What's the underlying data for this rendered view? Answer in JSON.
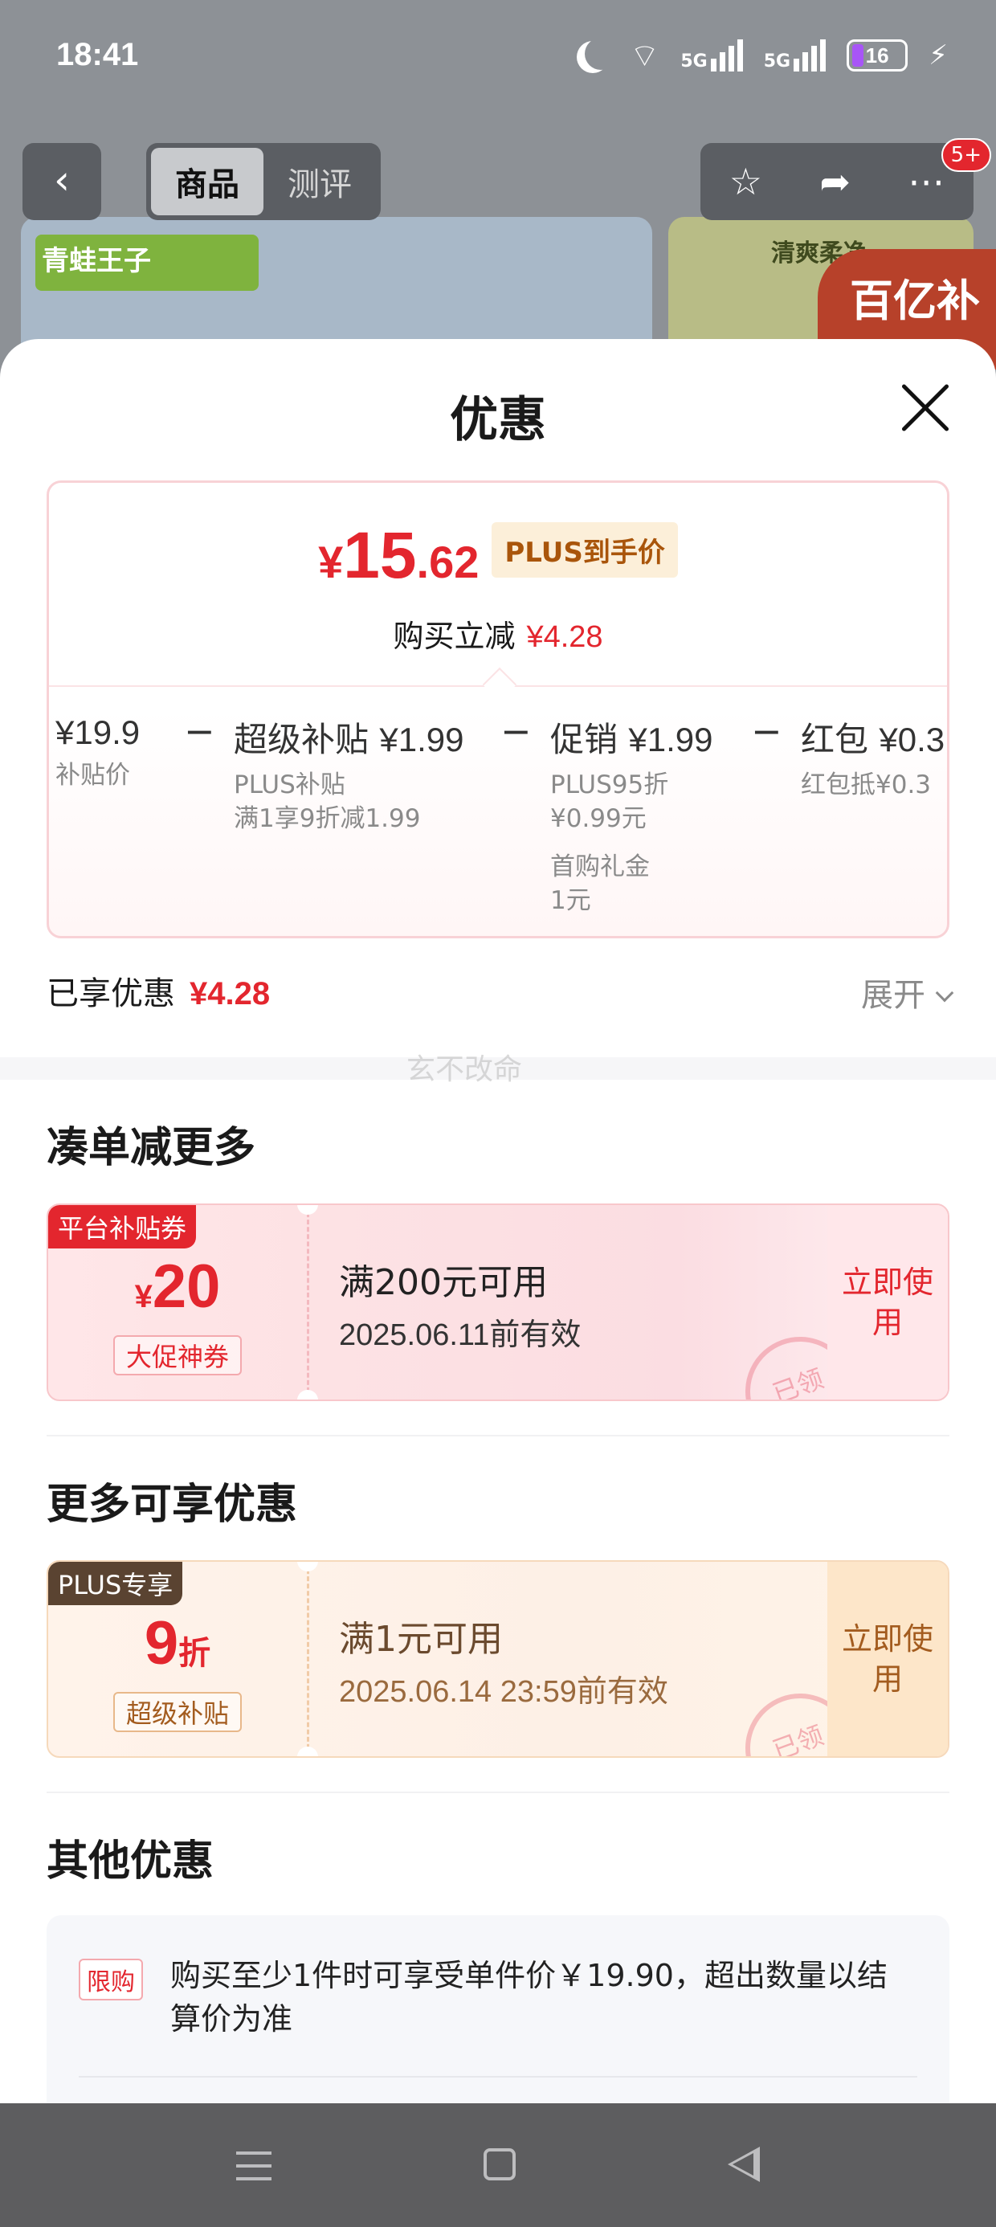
{
  "status_bar": {
    "time": "18:41",
    "signal1": "5G",
    "signal2": "5G",
    "battery": "16"
  },
  "product_nav": {
    "back_icon": "chevron-left-icon",
    "tabs": [
      "商品",
      "测评"
    ],
    "active_tab": "商品",
    "actions": [
      "star-icon",
      "share-icon",
      "more-icon"
    ],
    "badge": "5+"
  },
  "background": {
    "brand_logo": "青蛙王子",
    "product2_title": "清爽柔净",
    "tag": "百亿补贴"
  },
  "sheet": {
    "title": "优惠",
    "close_icon": "close-icon"
  },
  "price_card": {
    "currency": "¥",
    "price_int": "15",
    "price_dec": ".62",
    "plus_tag": "PLUS到手价",
    "instant_label": "购买立减",
    "instant_amount": "¥4.28",
    "breakdown": [
      {
        "main_label": "",
        "main_value": "¥19.9",
        "subs": [
          "补贴价"
        ]
      },
      {
        "main_label": "超级补贴 ",
        "main_value": "¥1.99",
        "subs": [
          "PLUS补贴",
          "满1享9折减1.99"
        ]
      },
      {
        "main_label": "促销 ",
        "main_value": "¥1.99",
        "subs": [
          "PLUS95折",
          "¥0.99元"
        ],
        "subs2": [
          "首购礼金",
          "1元"
        ]
      },
      {
        "main_label": "红包 ",
        "main_value": "¥0.3",
        "subs": [
          "红包抵¥0.3"
        ]
      }
    ],
    "minus": "−"
  },
  "enjoyed": {
    "label": "已享优惠",
    "amount": "¥4.28",
    "expand": "展开"
  },
  "watermark": "玄不改命",
  "section_more": {
    "title": "凑单减更多",
    "coupon": {
      "tag": "平台补贴券",
      "currency": "¥",
      "value": "20",
      "badge": "大促神券",
      "condition": "满200元可用",
      "expiry": "2025.06.11前有效",
      "action": "立即使用",
      "stamp": "已领"
    }
  },
  "section_extra": {
    "title": "更多可享优惠",
    "coupon": {
      "tag": "PLUS专享",
      "value": "9",
      "unit": "折",
      "badge": "超级补贴",
      "condition": "满1元可用",
      "expiry": "2025.06.14 23:59前有效",
      "action": "立即使用",
      "stamp": "已领"
    }
  },
  "section_other": {
    "title": "其他优惠",
    "limit_tag": "限购",
    "limit_text": "购买至少1件时可享受单件价￥19.90，超出数量以结算价为准"
  },
  "system_nav": {
    "menu_icon": "menu-icon",
    "home_icon": "home-icon",
    "back_icon": "back-icon"
  }
}
